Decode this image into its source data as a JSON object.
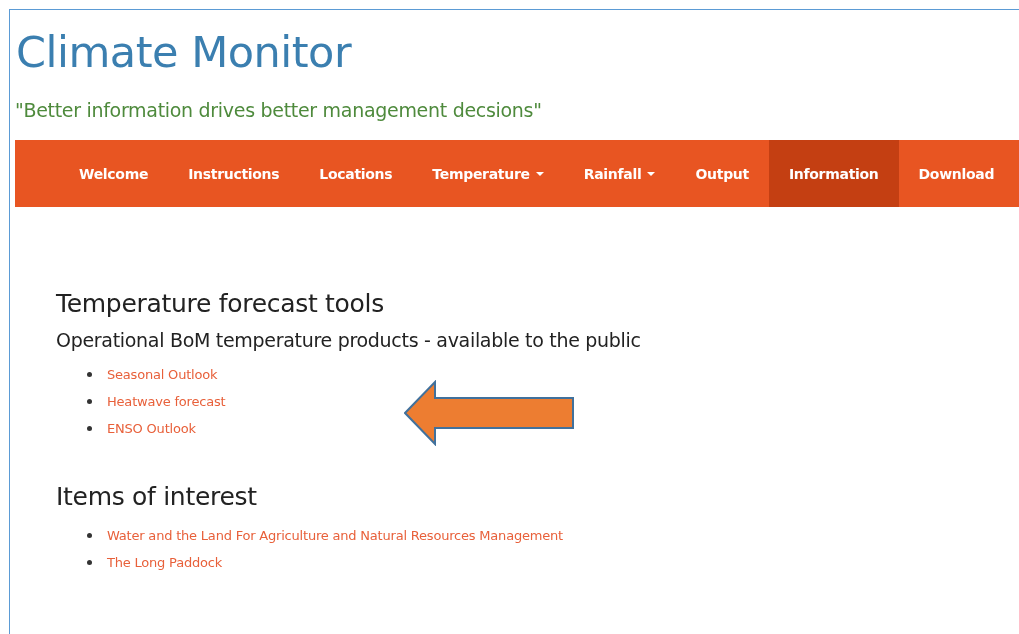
{
  "site_title": "Climate Monitor",
  "tagline": "\"Better information drives better management decsions\"",
  "nav": [
    {
      "label": "Welcome",
      "dropdown": false,
      "selected": false
    },
    {
      "label": "Instructions",
      "dropdown": false,
      "selected": false
    },
    {
      "label": "Locations",
      "dropdown": false,
      "selected": false
    },
    {
      "label": "Temperature",
      "dropdown": true,
      "selected": false
    },
    {
      "label": "Rainfall",
      "dropdown": true,
      "selected": false
    },
    {
      "label": "Output",
      "dropdown": false,
      "selected": false
    },
    {
      "label": "Information",
      "dropdown": false,
      "selected": true
    },
    {
      "label": "Download",
      "dropdown": false,
      "selected": false
    }
  ],
  "sections": [
    {
      "heading": "Temperature forecast tools",
      "subheading": "Operational BoM temperature products - available to the public",
      "links": [
        "Seasonal Outlook",
        "Heatwave forecast",
        "ENSO Outlook"
      ]
    },
    {
      "heading": "Items of interest",
      "links": [
        "Water and the Land For Agriculture and Natural Resources Management",
        "The Long Paddock"
      ]
    }
  ]
}
